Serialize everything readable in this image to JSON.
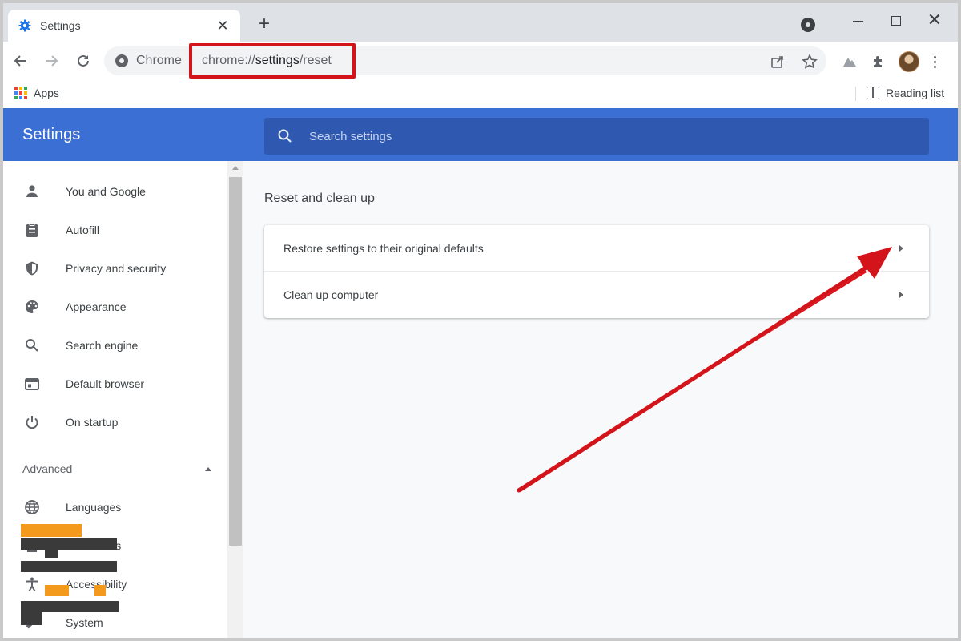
{
  "browser": {
    "tab_title": "Settings",
    "tab_close": "✕",
    "new_tab": "+",
    "site_chip": "Chrome",
    "url_prefix": "chrome://",
    "url_main": "settings",
    "url_suffix": "/reset",
    "window_close": "✕"
  },
  "bookmarks": {
    "apps_label": "Apps",
    "reading_list_label": "Reading list"
  },
  "settings": {
    "title": "Settings",
    "search_placeholder": "Search settings"
  },
  "sidebar": {
    "items": [
      {
        "label": "You and Google",
        "icon": "person-icon"
      },
      {
        "label": "Autofill",
        "icon": "clipboard-icon"
      },
      {
        "label": "Privacy and security",
        "icon": "shield-icon"
      },
      {
        "label": "Appearance",
        "icon": "palette-icon"
      },
      {
        "label": "Search engine",
        "icon": "search-icon"
      },
      {
        "label": "Default browser",
        "icon": "browser-window-icon"
      },
      {
        "label": "On startup",
        "icon": "power-icon"
      }
    ],
    "advanced_label": "Advanced",
    "advanced_items": [
      {
        "label": "Languages",
        "icon": "globe-icon"
      },
      {
        "label": "Downloads",
        "icon": "download-icon"
      },
      {
        "label": "Accessibility",
        "icon": "accessibility-icon"
      },
      {
        "label": "System",
        "icon": "wrench-icon"
      }
    ]
  },
  "main": {
    "section_title": "Reset and clean up",
    "rows": [
      {
        "label": "Restore settings to their original defaults"
      },
      {
        "label": "Clean up computer"
      }
    ]
  },
  "colors": {
    "header_blue": "#3b6fd4",
    "search_blue": "#2f59b0",
    "highlight_red": "#d3141a"
  }
}
